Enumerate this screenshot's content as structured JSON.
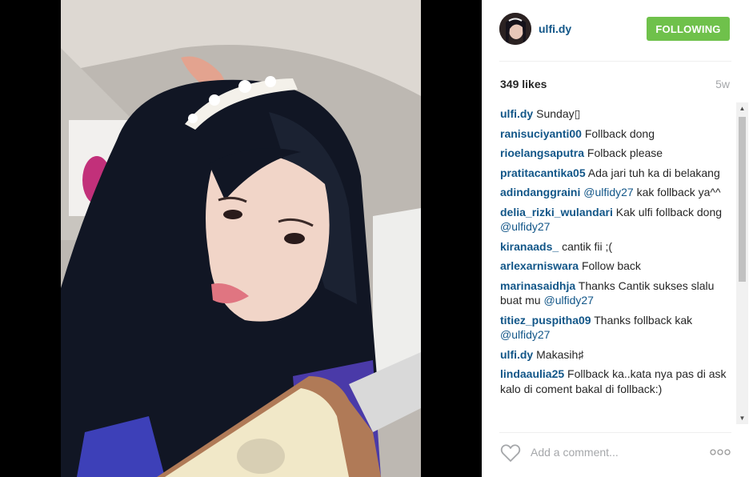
{
  "post": {
    "username": "ulfi.dy",
    "follow_label": "FOLLOWING",
    "likes": "349 likes",
    "age": "5w"
  },
  "comments": [
    {
      "user": "ulfi.dy",
      "text": "Sunday▯"
    },
    {
      "user": "ranisuciyanti00",
      "text": "Follback dong"
    },
    {
      "user": "rioelangsaputra",
      "text": "Folback please"
    },
    {
      "user": "pratitacantika05",
      "text": "Ada jari tuh ka di belakang"
    },
    {
      "user": "adindanggraini",
      "mention": "@ulfidy27",
      "text": "kak follback ya^^"
    },
    {
      "user": "delia_rizki_wulandari",
      "text": "Kak ulfi follback dong",
      "mention_after": "@ulfidy27"
    },
    {
      "user": "kiranaads_",
      "text": "cantik fii ;("
    },
    {
      "user": "arlexarniswara",
      "text": "Follow back"
    },
    {
      "user": "marinasaidhja",
      "text": "Thanks Cantik sukses slalu buat mu",
      "mention_after": "@ulfidy27"
    },
    {
      "user": "titiez_puspitha09",
      "text": "Thanks follback kak",
      "mention_after": "@ulfidy27"
    },
    {
      "user": "ulfi.dy",
      "text": "Makasih♯"
    },
    {
      "user": "lindaaulia25",
      "text": "Follback ka..kata nya pas di ask kalo di coment bakal di follback:)"
    }
  ],
  "input": {
    "placeholder": "Add a comment..."
  },
  "icons": {
    "like": "heart-icon",
    "more": "more-options-icon",
    "scroll_up": "scroll-up-arrow-icon",
    "scroll_down": "scroll-down-arrow-icon"
  },
  "colors": {
    "username_link": "#125688",
    "follow_button": "#6fc14b",
    "muted_text": "#a5a7aa"
  }
}
